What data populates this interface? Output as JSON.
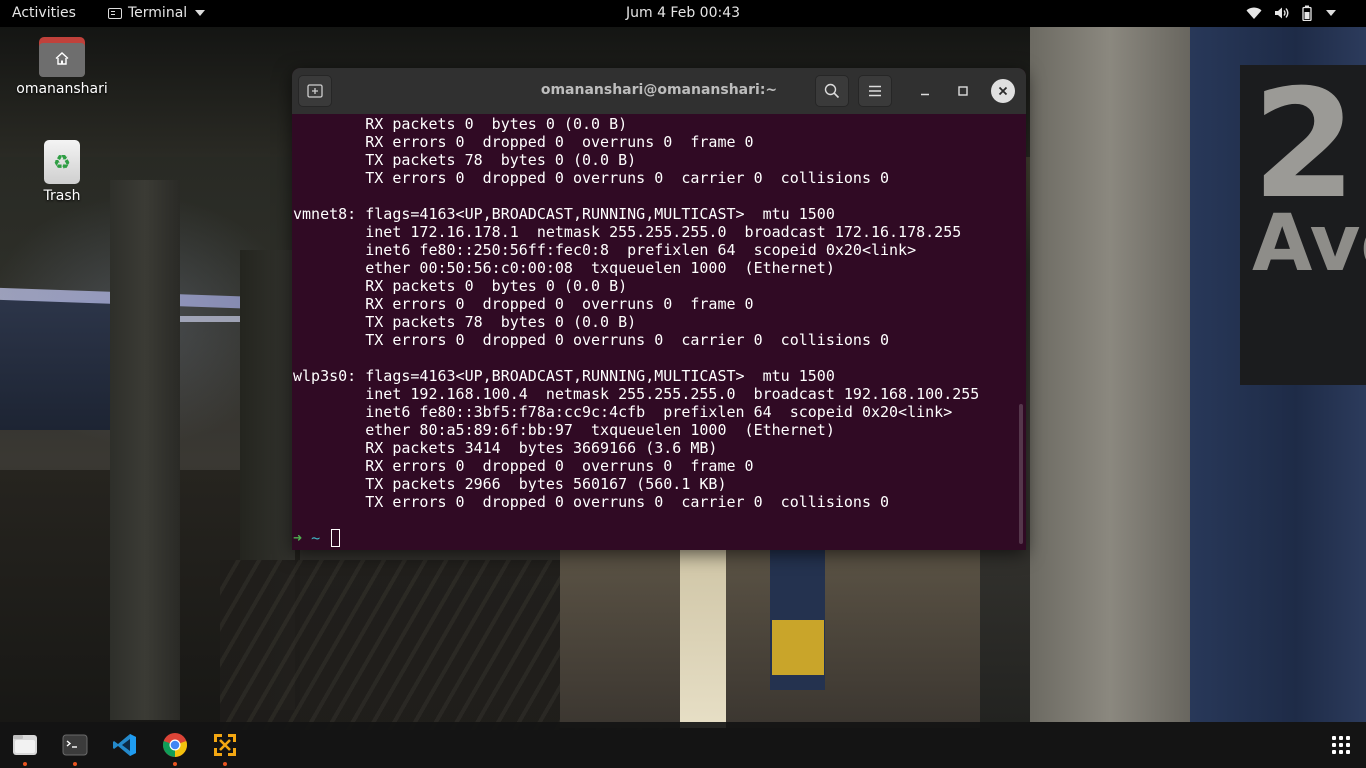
{
  "topbar": {
    "activities": "Activities",
    "app_name": "Terminal",
    "clock": "Jum  4 Feb  00:43",
    "status_icons": [
      "wifi-icon",
      "volume-icon",
      "battery-icon",
      "caret-down-icon"
    ]
  },
  "desktop": {
    "icons": [
      {
        "label": "omananshari",
        "icon": "home-folder-icon"
      },
      {
        "label": "Trash",
        "icon": "trash-icon"
      }
    ]
  },
  "terminal": {
    "title": "omananshari@omananshari:~",
    "output_lines": [
      "        RX packets 0  bytes 0 (0.0 B)",
      "        RX errors 0  dropped 0  overruns 0  frame 0",
      "        TX packets 78  bytes 0 (0.0 B)",
      "        TX errors 0  dropped 0 overruns 0  carrier 0  collisions 0",
      "",
      "vmnet8: flags=4163<UP,BROADCAST,RUNNING,MULTICAST>  mtu 1500",
      "        inet 172.16.178.1  netmask 255.255.255.0  broadcast 172.16.178.255",
      "        inet6 fe80::250:56ff:fec0:8  prefixlen 64  scopeid 0x20<link>",
      "        ether 00:50:56:c0:00:08  txqueuelen 1000  (Ethernet)",
      "        RX packets 0  bytes 0 (0.0 B)",
      "        RX errors 0  dropped 0  overruns 0  frame 0",
      "        TX packets 78  bytes 0 (0.0 B)",
      "        TX errors 0  dropped 0 overruns 0  carrier 0  collisions 0",
      "",
      "wlp3s0: flags=4163<UP,BROADCAST,RUNNING,MULTICAST>  mtu 1500",
      "        inet 192.168.100.4  netmask 255.255.255.0  broadcast 192.168.100.255",
      "        inet6 fe80::3bf5:f78a:cc9c:4cfb  prefixlen 64  scopeid 0x20<link>",
      "        ether 80:a5:89:6f:bb:97  txqueuelen 1000  (Ethernet)",
      "        RX packets 3414  bytes 3669166 (3.6 MB)",
      "        RX errors 0  dropped 0  overruns 0  frame 0",
      "        TX packets 2966  bytes 560167 (560.1 KB)",
      "        TX errors 0  dropped 0 overruns 0  carrier 0  collisions 0"
    ],
    "prompt_arrow": "➜",
    "prompt_dir": "~",
    "colors": {
      "background": "#300a24",
      "header": "#303030",
      "prompt_arrow": "#4eb04e",
      "prompt_dir": "#3fb6c6"
    }
  },
  "dock": {
    "apps": [
      {
        "name": "files-icon",
        "running": true
      },
      {
        "name": "terminal-icon",
        "running": true
      },
      {
        "name": "vscode-icon",
        "running": false
      },
      {
        "name": "chrome-icon",
        "running": true
      },
      {
        "name": "vmware-icon",
        "running": true
      }
    ],
    "show_apps": "show-applications-icon"
  },
  "wallpaper": {
    "sign_number": "2",
    "sign_text": "Ave"
  }
}
